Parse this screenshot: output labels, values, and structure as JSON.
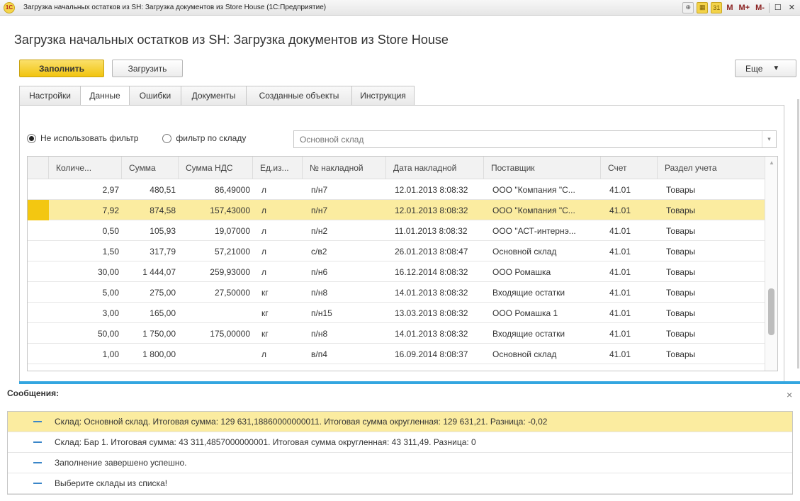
{
  "window": {
    "title": "Загрузка начальных остатков из SH: Загрузка документов из Store House  (1С:Предприятие)",
    "app_icon": "1c-logo-icon",
    "toolbar": [
      "M",
      "M+",
      "M-"
    ]
  },
  "page": {
    "title": "Загрузка начальных остатков из SH: Загрузка документов из Store House"
  },
  "buttons": {
    "fill": "Заполнить",
    "load": "Загрузить",
    "more": "Еще",
    "more_arrow": "▼"
  },
  "tabs": [
    {
      "label": "Настройки"
    },
    {
      "label": "Данные"
    },
    {
      "label": "Ошибки"
    },
    {
      "label": "Документы"
    },
    {
      "label": "Созданные объекты"
    },
    {
      "label": "Инструкция"
    }
  ],
  "active_tab": "Данные",
  "filter": {
    "option_no_filter": "Не использовать фильтр",
    "option_by_warehouse": "фильтр по складу",
    "selected": "Не использовать фильтр",
    "warehouse_value": "Основной склад"
  },
  "table": {
    "columns": [
      "Количе...",
      "Сумма",
      "Сумма НДС",
      "Ед.из...",
      "№ накладной",
      "Дата накладной",
      "Поставщик",
      "Счет",
      "Раздел учета"
    ],
    "selected_row": 1,
    "rows": [
      [
        "2,97",
        "480,51",
        "86,49000",
        "л",
        "п/н7",
        "12.01.2013 8:08:32",
        "ООО \"Компания \"С...",
        "41.01",
        "Товары"
      ],
      [
        "7,92",
        "874,58",
        "157,43000",
        "л",
        "п/н7",
        "12.01.2013 8:08:32",
        "ООО \"Компания \"С...",
        "41.01",
        "Товары"
      ],
      [
        "0,50",
        "105,93",
        "19,07000",
        "л",
        "п/н2",
        "11.01.2013 8:08:32",
        "ООО \"АСТ-интернэ...",
        "41.01",
        "Товары"
      ],
      [
        "1,50",
        "317,79",
        "57,21000",
        "л",
        "с/в2",
        "26.01.2013 8:08:47",
        "Основной склад",
        "41.01",
        "Товары"
      ],
      [
        "30,00",
        "1 444,07",
        "259,93000",
        "л",
        "п/н6",
        "16.12.2014 8:08:32",
        "ООО Ромашка",
        "41.01",
        "Товары"
      ],
      [
        "5,00",
        "275,00",
        "27,50000",
        "кг",
        "п/н8",
        "14.01.2013 8:08:32",
        "Входящие остатки",
        "41.01",
        "Товары"
      ],
      [
        "3,00",
        "165,00",
        "",
        "кг",
        "п/н15",
        "13.03.2013 8:08:32",
        "ООО Ромашка 1",
        "41.01",
        "Товары"
      ],
      [
        "50,00",
        "1 750,00",
        "175,00000",
        "кг",
        "п/н8",
        "14.01.2013 8:08:32",
        "Входящие остатки",
        "41.01",
        "Товары"
      ],
      [
        "1,00",
        "1 800,00",
        "",
        "л",
        "в/п4",
        "16.09.2014 8:08:37",
        "Основной склад",
        "41.01",
        "Товары"
      ]
    ]
  },
  "messages": {
    "title": "Сообщения:",
    "close": "×",
    "selected_index": 0,
    "items": [
      "Склад: Основной склад. Итоговая сумма: 129 631,18860000000011. Итоговая сумма округленная: 129 631,21. Разница: -0,02",
      "Склад: Бар 1. Итоговая сумма: 43 311,4857000000001. Итоговая сумма округленная: 43 311,49. Разница: 0",
      "Заполнение завершено успешно.",
      "Выберите склады из списка!"
    ]
  }
}
